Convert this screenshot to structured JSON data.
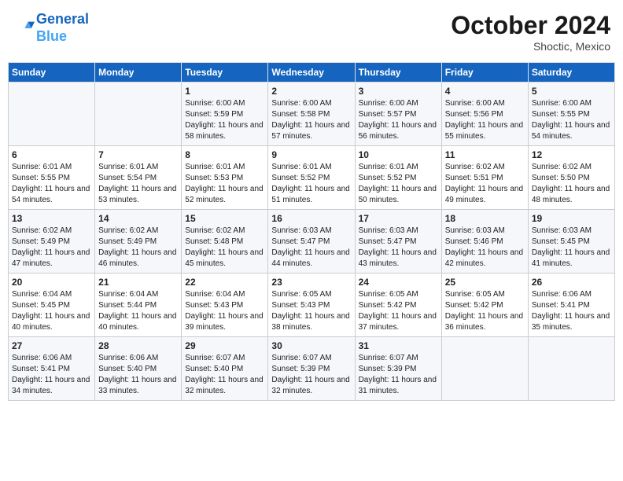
{
  "header": {
    "logo_line1": "General",
    "logo_line2": "Blue",
    "month": "October 2024",
    "location": "Shoctic, Mexico"
  },
  "days_of_week": [
    "Sunday",
    "Monday",
    "Tuesday",
    "Wednesday",
    "Thursday",
    "Friday",
    "Saturday"
  ],
  "weeks": [
    [
      {
        "day": "",
        "info": ""
      },
      {
        "day": "",
        "info": ""
      },
      {
        "day": "1",
        "info": "Sunrise: 6:00 AM\nSunset: 5:59 PM\nDaylight: 11 hours and 58 minutes."
      },
      {
        "day": "2",
        "info": "Sunrise: 6:00 AM\nSunset: 5:58 PM\nDaylight: 11 hours and 57 minutes."
      },
      {
        "day": "3",
        "info": "Sunrise: 6:00 AM\nSunset: 5:57 PM\nDaylight: 11 hours and 56 minutes."
      },
      {
        "day": "4",
        "info": "Sunrise: 6:00 AM\nSunset: 5:56 PM\nDaylight: 11 hours and 55 minutes."
      },
      {
        "day": "5",
        "info": "Sunrise: 6:00 AM\nSunset: 5:55 PM\nDaylight: 11 hours and 54 minutes."
      }
    ],
    [
      {
        "day": "6",
        "info": "Sunrise: 6:01 AM\nSunset: 5:55 PM\nDaylight: 11 hours and 54 minutes."
      },
      {
        "day": "7",
        "info": "Sunrise: 6:01 AM\nSunset: 5:54 PM\nDaylight: 11 hours and 53 minutes."
      },
      {
        "day": "8",
        "info": "Sunrise: 6:01 AM\nSunset: 5:53 PM\nDaylight: 11 hours and 52 minutes."
      },
      {
        "day": "9",
        "info": "Sunrise: 6:01 AM\nSunset: 5:52 PM\nDaylight: 11 hours and 51 minutes."
      },
      {
        "day": "10",
        "info": "Sunrise: 6:01 AM\nSunset: 5:52 PM\nDaylight: 11 hours and 50 minutes."
      },
      {
        "day": "11",
        "info": "Sunrise: 6:02 AM\nSunset: 5:51 PM\nDaylight: 11 hours and 49 minutes."
      },
      {
        "day": "12",
        "info": "Sunrise: 6:02 AM\nSunset: 5:50 PM\nDaylight: 11 hours and 48 minutes."
      }
    ],
    [
      {
        "day": "13",
        "info": "Sunrise: 6:02 AM\nSunset: 5:49 PM\nDaylight: 11 hours and 47 minutes."
      },
      {
        "day": "14",
        "info": "Sunrise: 6:02 AM\nSunset: 5:49 PM\nDaylight: 11 hours and 46 minutes."
      },
      {
        "day": "15",
        "info": "Sunrise: 6:02 AM\nSunset: 5:48 PM\nDaylight: 11 hours and 45 minutes."
      },
      {
        "day": "16",
        "info": "Sunrise: 6:03 AM\nSunset: 5:47 PM\nDaylight: 11 hours and 44 minutes."
      },
      {
        "day": "17",
        "info": "Sunrise: 6:03 AM\nSunset: 5:47 PM\nDaylight: 11 hours and 43 minutes."
      },
      {
        "day": "18",
        "info": "Sunrise: 6:03 AM\nSunset: 5:46 PM\nDaylight: 11 hours and 42 minutes."
      },
      {
        "day": "19",
        "info": "Sunrise: 6:03 AM\nSunset: 5:45 PM\nDaylight: 11 hours and 41 minutes."
      }
    ],
    [
      {
        "day": "20",
        "info": "Sunrise: 6:04 AM\nSunset: 5:45 PM\nDaylight: 11 hours and 40 minutes."
      },
      {
        "day": "21",
        "info": "Sunrise: 6:04 AM\nSunset: 5:44 PM\nDaylight: 11 hours and 40 minutes."
      },
      {
        "day": "22",
        "info": "Sunrise: 6:04 AM\nSunset: 5:43 PM\nDaylight: 11 hours and 39 minutes."
      },
      {
        "day": "23",
        "info": "Sunrise: 6:05 AM\nSunset: 5:43 PM\nDaylight: 11 hours and 38 minutes."
      },
      {
        "day": "24",
        "info": "Sunrise: 6:05 AM\nSunset: 5:42 PM\nDaylight: 11 hours and 37 minutes."
      },
      {
        "day": "25",
        "info": "Sunrise: 6:05 AM\nSunset: 5:42 PM\nDaylight: 11 hours and 36 minutes."
      },
      {
        "day": "26",
        "info": "Sunrise: 6:06 AM\nSunset: 5:41 PM\nDaylight: 11 hours and 35 minutes."
      }
    ],
    [
      {
        "day": "27",
        "info": "Sunrise: 6:06 AM\nSunset: 5:41 PM\nDaylight: 11 hours and 34 minutes."
      },
      {
        "day": "28",
        "info": "Sunrise: 6:06 AM\nSunset: 5:40 PM\nDaylight: 11 hours and 33 minutes."
      },
      {
        "day": "29",
        "info": "Sunrise: 6:07 AM\nSunset: 5:40 PM\nDaylight: 11 hours and 32 minutes."
      },
      {
        "day": "30",
        "info": "Sunrise: 6:07 AM\nSunset: 5:39 PM\nDaylight: 11 hours and 32 minutes."
      },
      {
        "day": "31",
        "info": "Sunrise: 6:07 AM\nSunset: 5:39 PM\nDaylight: 11 hours and 31 minutes."
      },
      {
        "day": "",
        "info": ""
      },
      {
        "day": "",
        "info": ""
      }
    ]
  ]
}
